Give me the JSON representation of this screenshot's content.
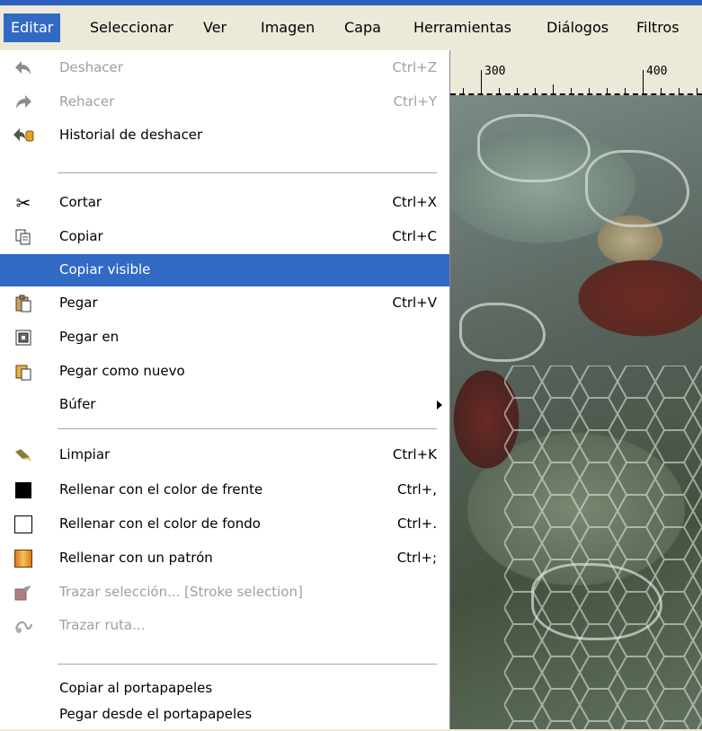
{
  "menubar": {
    "items": [
      {
        "label": "Editar"
      },
      {
        "label": "Seleccionar"
      },
      {
        "label": "Ver"
      },
      {
        "label": "Imagen"
      },
      {
        "label": "Capa"
      },
      {
        "label": "Herramientas"
      },
      {
        "label": "Diálogos"
      },
      {
        "label": "Filtros"
      }
    ]
  },
  "ruler": {
    "labels": [
      "300",
      "400"
    ]
  },
  "menu": {
    "items": [
      {
        "label": "Deshacer",
        "shortcut": "Ctrl+Z",
        "icon": "undo-icon",
        "disabled": true
      },
      {
        "label": "Rehacer",
        "shortcut": "Ctrl+Y",
        "icon": "redo-icon",
        "disabled": true
      },
      {
        "label": "Historial de deshacer",
        "shortcut": "",
        "icon": "undo-history-icon",
        "disabled": false
      },
      {
        "label": "Cortar",
        "shortcut": "Ctrl+X",
        "icon": "scissors-icon",
        "disabled": false
      },
      {
        "label": "Copiar",
        "shortcut": "Ctrl+C",
        "icon": "copy-icon",
        "disabled": false
      },
      {
        "label": "Copiar visible",
        "shortcut": "",
        "icon": "",
        "disabled": false,
        "highlighted": true
      },
      {
        "label": "Pegar",
        "shortcut": "Ctrl+V",
        "icon": "paste-icon",
        "disabled": false
      },
      {
        "label": "Pegar en",
        "shortcut": "",
        "icon": "paste-into-icon",
        "disabled": false
      },
      {
        "label": "Pegar como nuevo",
        "shortcut": "",
        "icon": "paste-as-new-icon",
        "disabled": false
      },
      {
        "label": "Búfer",
        "shortcut": "",
        "icon": "",
        "disabled": false,
        "submenu": true
      },
      {
        "label": "Limpiar",
        "shortcut": "Ctrl+K",
        "icon": "eraser-icon",
        "disabled": false
      },
      {
        "label": "Rellenar con el color de frente",
        "shortcut": "Ctrl+,",
        "icon": "fill-fg-icon",
        "disabled": false
      },
      {
        "label": "Rellenar con el color de fondo",
        "shortcut": "Ctrl+.",
        "icon": "fill-bg-icon",
        "disabled": false
      },
      {
        "label": "Rellenar con un patrón",
        "shortcut": "Ctrl+;",
        "icon": "fill-pattern-icon",
        "disabled": false
      },
      {
        "label": "Trazar selección... [Stroke selection]",
        "shortcut": "",
        "icon": "stroke-selection-icon",
        "disabled": true
      },
      {
        "label": "Trazar ruta...",
        "shortcut": "",
        "icon": "stroke-path-icon",
        "disabled": true
      },
      {
        "label": "Copiar al portapapeles",
        "shortcut": "",
        "icon": "",
        "disabled": false
      },
      {
        "label": "Pegar desde el portapapeles",
        "shortcut": "",
        "icon": "",
        "disabled": false
      }
    ]
  },
  "colors": {
    "highlight": "#316ac5",
    "menubar_bg": "#ece9d8",
    "fill_fg": "#000000",
    "fill_bg": "#ffffff",
    "pattern": "#f0a030"
  }
}
